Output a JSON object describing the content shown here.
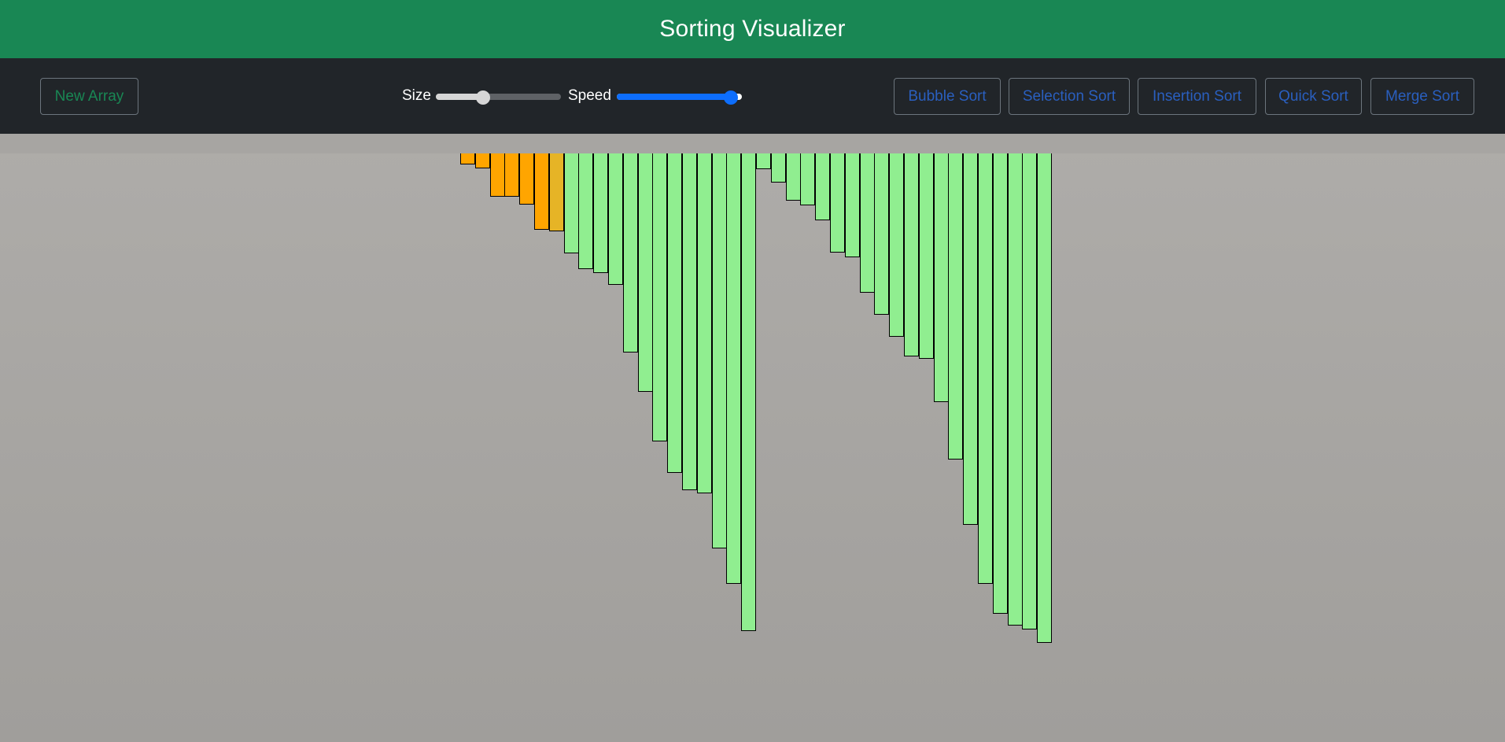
{
  "header": {
    "title": "Sorting Visualizer"
  },
  "toolbar": {
    "new_array_label": "New Array",
    "size_label": "Size",
    "speed_label": "Speed",
    "size_value": 0.38,
    "speed_value": 0.91,
    "sort_buttons": [
      "Bubble Sort",
      "Selection Sort",
      "Insertion Sort",
      "Quick Sort",
      "Merge Sort"
    ]
  },
  "colors": {
    "header_bg": "#198754",
    "toolbar_bg": "#212529",
    "sorted_bar": "#90ee90",
    "active_bar": "#ffa500",
    "compare_bar": "#e6b426",
    "size_slider_fill": "#d6d6d6",
    "speed_slider_fill": "#0d6efd"
  },
  "array": {
    "values": [
      14,
      19,
      55,
      55,
      65,
      97,
      99,
      127,
      147,
      152,
      167,
      253,
      303,
      366,
      406,
      428,
      432,
      502,
      547,
      607,
      20,
      37,
      60,
      66,
      85,
      126,
      132,
      177,
      205,
      233,
      258,
      261,
      316,
      389,
      472,
      547,
      585,
      600,
      605,
      622
    ],
    "states": [
      "active",
      "active",
      "active",
      "active",
      "active",
      "active",
      "compare",
      "sorted",
      "sorted",
      "sorted",
      "sorted",
      "sorted",
      "sorted",
      "sorted",
      "sorted",
      "sorted",
      "sorted",
      "sorted",
      "sorted",
      "sorted",
      "sorted",
      "sorted",
      "sorted",
      "sorted",
      "sorted",
      "sorted",
      "sorted",
      "sorted",
      "sorted",
      "sorted",
      "sorted",
      "sorted",
      "sorted",
      "sorted",
      "sorted",
      "sorted",
      "sorted",
      "sorted",
      "sorted",
      "sorted"
    ]
  }
}
